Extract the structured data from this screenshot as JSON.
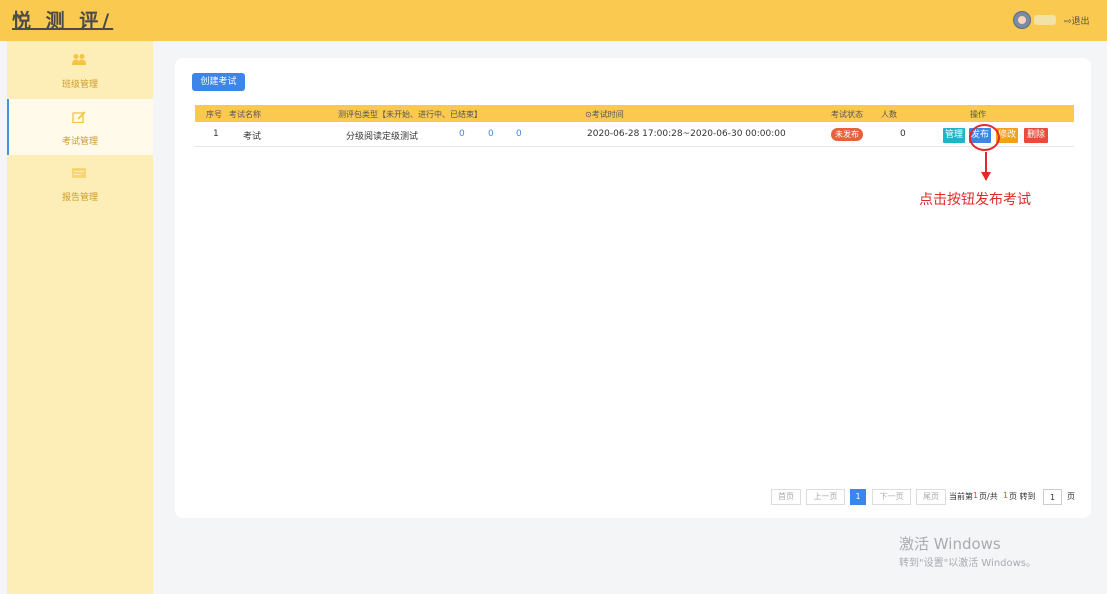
{
  "header": {
    "logo": "悦 测 评/",
    "logout_label": "⇨退出"
  },
  "sidebar": {
    "items": [
      {
        "label": "班级管理",
        "icon": "users-icon"
      },
      {
        "label": "考试管理",
        "icon": "edit-icon",
        "active": true
      },
      {
        "label": "报告管理",
        "icon": "report-icon"
      }
    ]
  },
  "main": {
    "create_button": "创建考试",
    "table": {
      "headers": [
        "序号",
        "考试名称",
        "测评包类型【未开始、进行中、已结束】",
        "⊙考试时间",
        "考试状态",
        "人数",
        "操作"
      ],
      "rows": [
        {
          "index": "1",
          "name": "考试",
          "package_type": "分级阅读定级测试",
          "not_started": "0",
          "in_progress": "0",
          "ended": "0",
          "time": "2020-06-28 17:00:28~2020-06-30 00:00:00",
          "status": "未发布",
          "count": "0",
          "actions": {
            "manage": "管理",
            "publish": "发布",
            "edit": "修改",
            "delete": "删除"
          }
        }
      ]
    },
    "pagination": {
      "first": "首页",
      "prev": "上一页",
      "current": "1",
      "next": "下一页",
      "last": "尾页",
      "info_prefix": "当前第",
      "info_current": "1",
      "info_mid": "页/共",
      "info_total": "1",
      "info_suffix": "页 转到",
      "goto_value": "1",
      "goto_suffix": "页"
    }
  },
  "annotation": {
    "text": "点击按钮发布考试",
    "color": "#e12a2a"
  },
  "watermark": {
    "line1": "激活 Windows",
    "line2": "转到\"设置\"以激活 Windows。"
  },
  "colors": {
    "topbar": "#f9c950",
    "sidebar": "#fdeeb8",
    "primary": "#3b86e8",
    "status_unpublished": "#e8603c"
  }
}
